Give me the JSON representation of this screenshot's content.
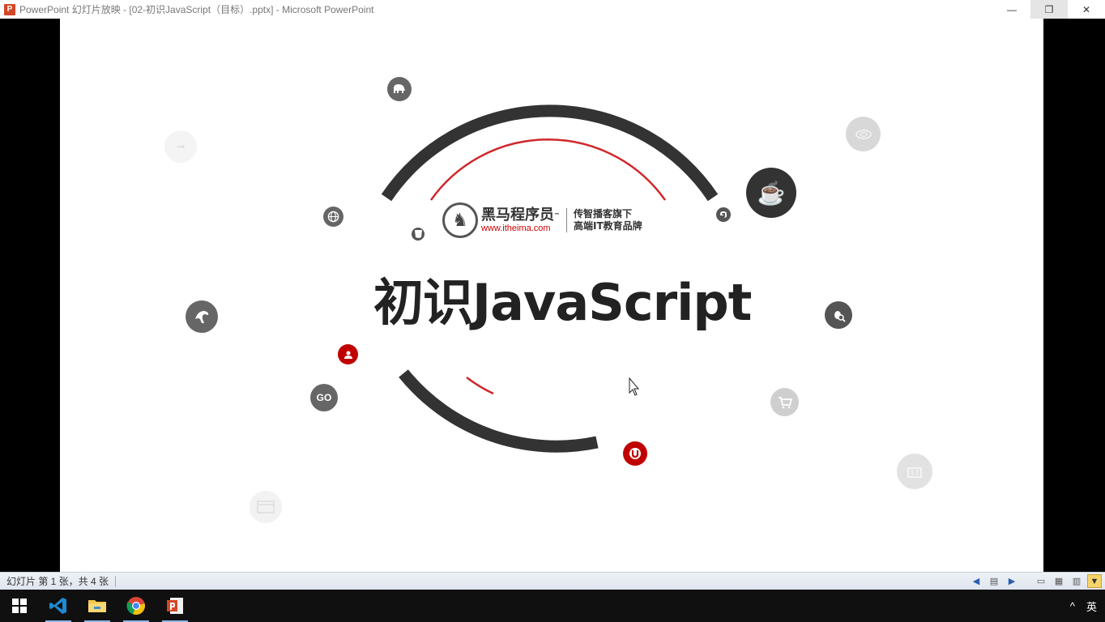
{
  "window": {
    "app_icon_letter": "P",
    "title": "PowerPoint 幻灯片放映 - [02-初识JavaScript（目标）.pptx] - Microsoft PowerPoint",
    "controls": {
      "minimize": "—",
      "restore": "❐",
      "close": "✕"
    }
  },
  "slide": {
    "title": "初识JavaScript",
    "logo": {
      "name": "黑马程序员",
      "tm": "™",
      "url": "www.itheima.com",
      "tagline_1": "传智播客旗下",
      "tagline_2": "高端IT教育品牌"
    },
    "icons": {
      "go_label": "GO",
      "java_glyph": "☕",
      "globe_glyph": "🌐",
      "elephant_glyph": "🐘"
    },
    "colors": {
      "arc_dark": "#333333",
      "arc_red": "#d0262b",
      "accent_red": "#c00000",
      "icon_gray": "#666666",
      "icon_light": "#dddddd"
    }
  },
  "statusbar": {
    "slide_info": "幻灯片 第 1 张，共 4 张"
  },
  "taskbar": {
    "ime": "英",
    "tray_arrow": "^"
  }
}
